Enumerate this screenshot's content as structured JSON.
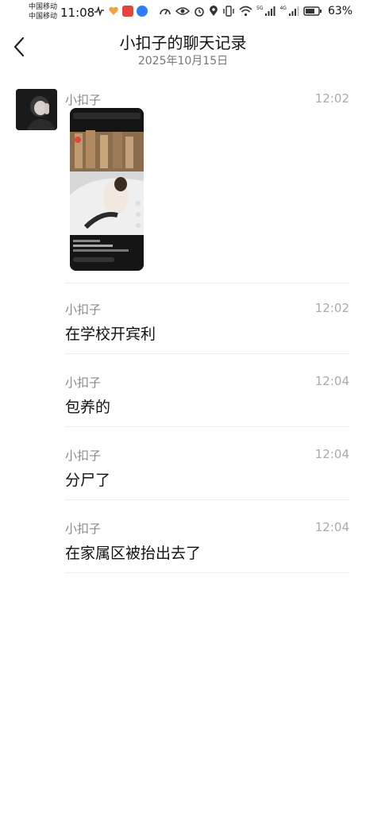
{
  "status_bar": {
    "carrier1": "中国移动",
    "carrier2": "中国移动",
    "time": "11:08",
    "sig1_label": "5G",
    "sig2_label": "4G",
    "battery": "63%"
  },
  "header": {
    "title": "小扣子的聊天记录",
    "date": "2025年10月15日"
  },
  "messages": [
    {
      "sender": "小扣子",
      "time": "12:02",
      "text": ""
    },
    {
      "sender": "小扣子",
      "time": "12:02",
      "text": "在学校开宾利"
    },
    {
      "sender": "小扣子",
      "time": "12:04",
      "text": "包养的"
    },
    {
      "sender": "小扣子",
      "time": "12:04",
      "text": "分尸了"
    },
    {
      "sender": "小扣子",
      "time": "12:04",
      "text": "在家属区被抬出去了"
    }
  ],
  "colors": {
    "accent_app_red": "#e3453c",
    "accent_app_orange": "#f2a33a",
    "accent_app_blue": "#2f7df6"
  },
  "icons": [
    "back-chevron-icon",
    "wifi-icon",
    "battery-icon",
    "location-icon",
    "alarm-icon",
    "eye-icon"
  ]
}
